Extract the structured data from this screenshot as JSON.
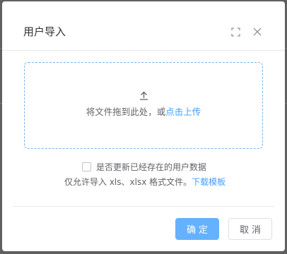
{
  "dialog": {
    "title": "用户导入",
    "fullscreen_icon": "fullscreen-icon",
    "close_icon": "close-icon"
  },
  "upload": {
    "icon": "upload-icon",
    "text_prefix": "将文件拖到此处，或",
    "text_link": "点击上传"
  },
  "update_option": {
    "checked": false,
    "label": "是否更新已经存在的用户数据"
  },
  "tip": {
    "text": "仅允许导入 xls、xlsx 格式文件。",
    "link": "下载模板"
  },
  "footer": {
    "confirm_label": "确定",
    "cancel_label": "取消"
  },
  "colors": {
    "primary": "#66b1ff",
    "link": "#409eff",
    "dashed_border": "#7ab0f0"
  }
}
